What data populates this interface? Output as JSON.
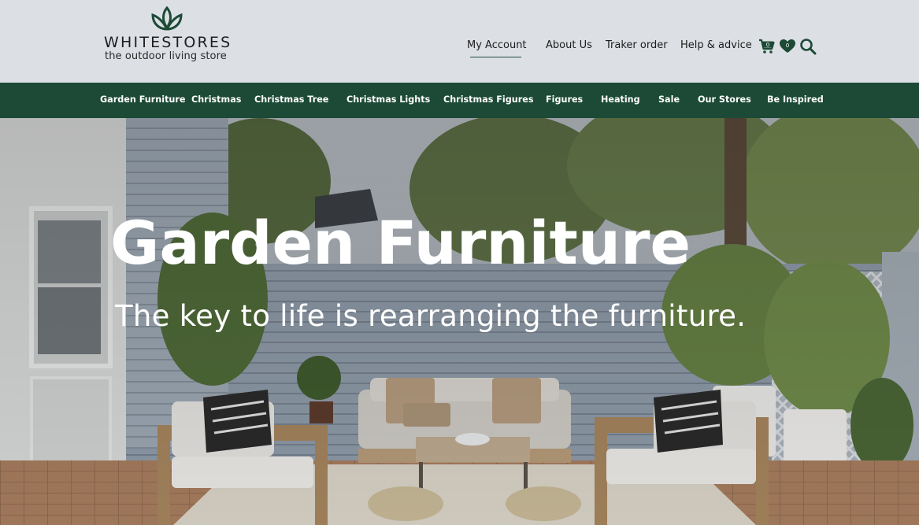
{
  "brand": {
    "name": "WHITESTORES",
    "tagline": "the outdoor living store",
    "logo_icon": "lotus-leaf-icon",
    "brand_color": "#1c4a36"
  },
  "top_links": [
    {
      "label": "My Account",
      "active": true
    },
    {
      "label": "About Us"
    },
    {
      "label": "Traker order"
    },
    {
      "label": "Help & advice"
    }
  ],
  "header_icons": {
    "cart": {
      "icon": "cart-icon",
      "count": "0"
    },
    "wishlist": {
      "icon": "heart-icon",
      "count": "0"
    },
    "search": {
      "icon": "search-icon"
    }
  },
  "nav": [
    "Garden Furniture",
    "Christmas",
    "Christmas Tree",
    "Christmas Lights",
    "Christmas Figures",
    "Figures",
    "Heating",
    "Sale",
    "Our Stores",
    "Be Inspired"
  ],
  "hero": {
    "title": "Garden Furniture",
    "subtitle": "The key to life is rearranging the furniture."
  }
}
